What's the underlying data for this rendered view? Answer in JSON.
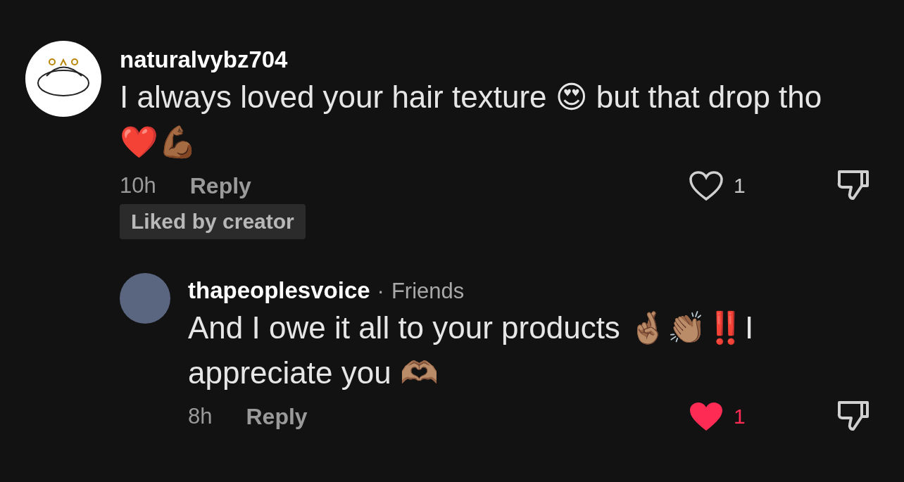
{
  "comments": [
    {
      "username": "naturalvybz704",
      "avatar": {
        "kind": "logo"
      },
      "text": "I always loved your hair texture 😍 but that drop tho ❤️💪🏾",
      "time": "10h",
      "reply_label": "Reply",
      "likes": "1",
      "liked": false,
      "creator_badge": "Liked by creator",
      "replies": [
        {
          "username": "thapeoplesvoice",
          "avatar": {
            "kind": "photo"
          },
          "separator": "·",
          "relation": "Friends",
          "text": "And I owe it all to your products 🤞🏽👏🏽‼️I appreciate you 🫶🏽",
          "time": "8h",
          "reply_label": "Reply",
          "likes": "1",
          "liked": true
        }
      ]
    }
  ]
}
